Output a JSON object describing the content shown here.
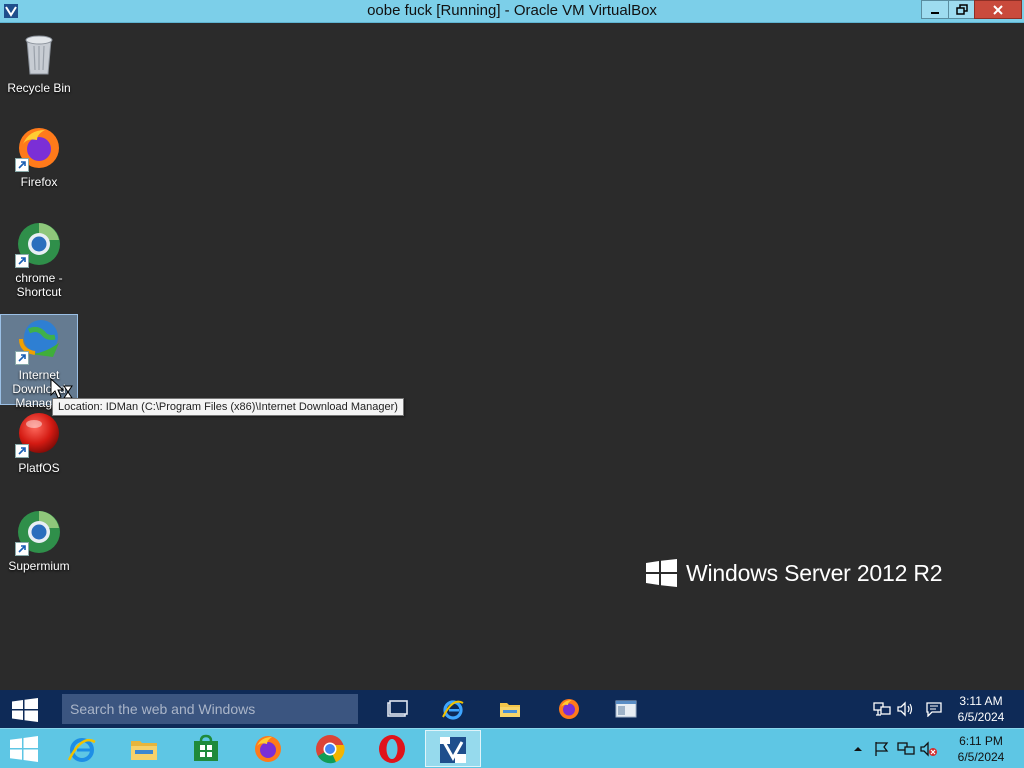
{
  "host_window": {
    "title": "oobe fuck [Running] - Oracle VM VirtualBox",
    "controls": [
      "minimize",
      "restore",
      "close"
    ]
  },
  "desktop_icons": [
    {
      "label": "Recycle Bin",
      "icon": "recycle-bin-icon",
      "shortcut": false
    },
    {
      "label": "Firefox",
      "icon": "firefox-icon",
      "shortcut": true
    },
    {
      "label": "chrome - Shortcut",
      "icon": "chromium-icon",
      "shortcut": true
    },
    {
      "label": "Internet Download Manager",
      "icon": "idm-icon",
      "shortcut": true,
      "selected": true
    },
    {
      "label": "PlatfOS",
      "icon": "red-orb-icon",
      "shortcut": true
    },
    {
      "label": "Supermium",
      "icon": "supermium-icon",
      "shortcut": true
    }
  ],
  "tooltip": "Location: IDMan (C:\\Program Files (x86)\\Internet Download Manager)",
  "brand": "Windows Server 2012 R2",
  "guest_taskbar": {
    "search_placeholder": "Search the web and Windows",
    "pinned": [
      "task-view-icon",
      "internet-explorer-icon",
      "file-explorer-icon",
      "firefox-icon",
      "app-window-icon"
    ],
    "time": "3:11 AM",
    "date": "6/5/2024"
  },
  "host_taskbar": {
    "pinned": [
      "internet-explorer-icon",
      "file-explorer-icon",
      "store-icon",
      "firefox-icon",
      "chrome-icon",
      "opera-icon",
      "virtualbox-icon"
    ],
    "time": "6:11 PM",
    "date": "6/5/2024"
  },
  "colors": {
    "vbox_titlebar": "#7ccfe9",
    "desktop_bg": "#2b2b2b",
    "guest_taskbar": "#0e2a57",
    "host_taskbar": "#5ec6e4"
  }
}
